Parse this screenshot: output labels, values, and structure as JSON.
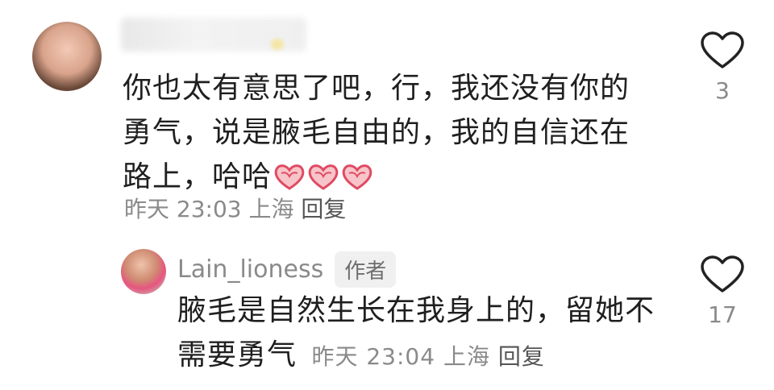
{
  "comments": [
    {
      "text_line1": "你也太有意思了吧，行，我还没有你的",
      "text_line2": "勇气，说是腋毛自由的，我的自信还在",
      "text_line3": "路上，哈哈",
      "emoji_name": "heart-hands-emoji",
      "time": "昨天 23:03",
      "location": "上海",
      "reply_label": "回复",
      "likes": "3"
    },
    {
      "username": "Lain_lioness",
      "author_badge": "作者",
      "text_line1": "腋毛是自然生长在我身上的，留她不",
      "text_line2": "需要勇气",
      "time": "昨天 23:04",
      "location": "上海",
      "reply_label": "回复",
      "likes": "17"
    }
  ],
  "colors": {
    "heart_outline": "#222222",
    "muted_text": "#8a8a8a",
    "emoji_red": "#e04a63"
  }
}
